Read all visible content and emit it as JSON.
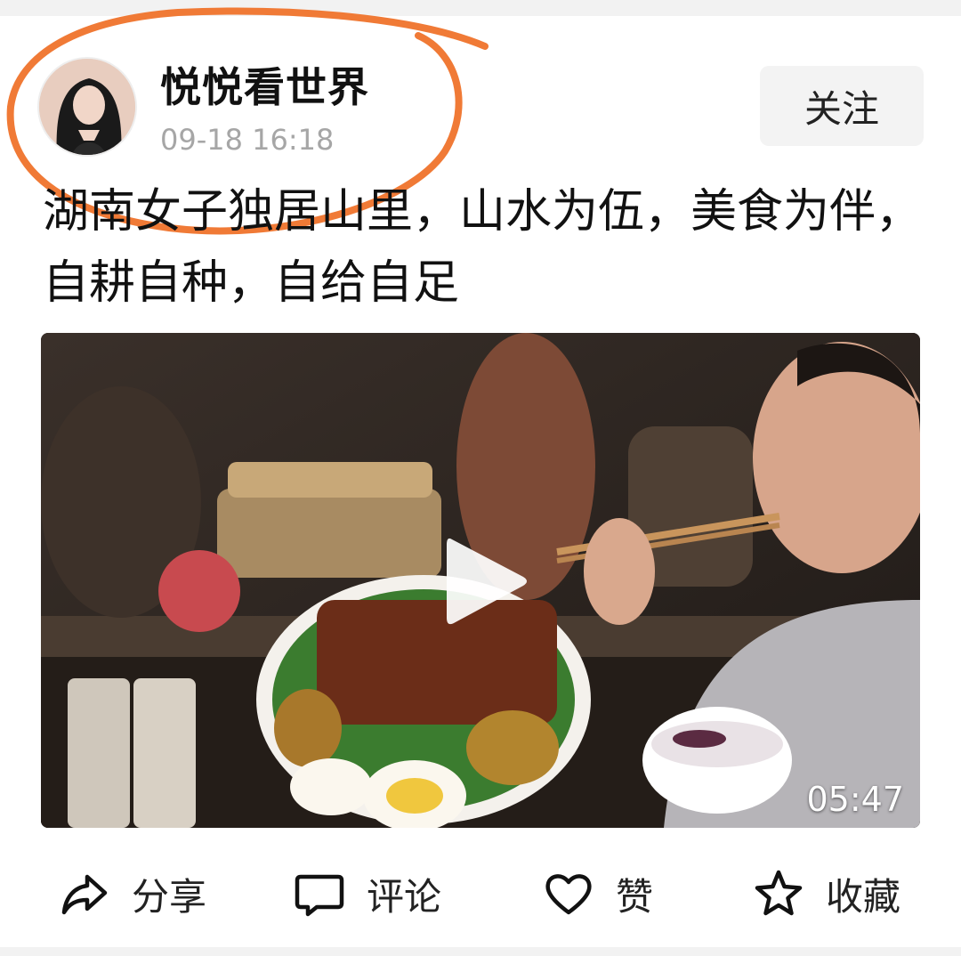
{
  "post": {
    "author_name": "悦悦看世界",
    "timestamp": "09-18 16:18",
    "follow_label": "关注",
    "title": "湖南女子独居山里，山水为伍，美食为伴，自耕自种，自给自足"
  },
  "video": {
    "duration": "05:47"
  },
  "actions": {
    "share_label": "分享",
    "comment_label": "评论",
    "like_label": "赞",
    "favorite_label": "收藏"
  },
  "icons": {
    "share": "share-arrow-icon",
    "comment": "comment-bubble-icon",
    "like": "heart-icon",
    "favorite": "star-icon",
    "play": "play-icon"
  },
  "colors": {
    "annotation": "#f07a36",
    "follow_bg": "#f3f3f3",
    "timestamp": "#a6a6a6"
  }
}
